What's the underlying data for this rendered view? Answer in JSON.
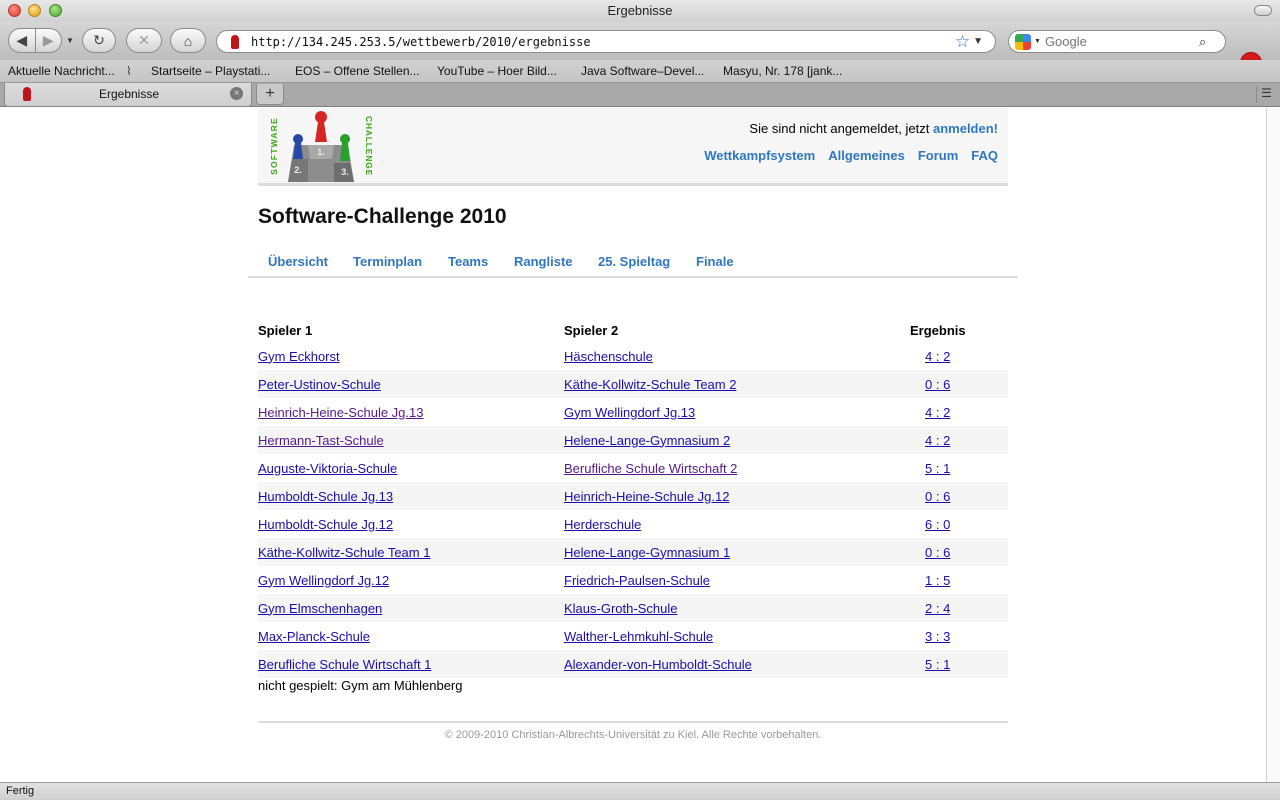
{
  "window": {
    "title": "Ergebnisse"
  },
  "toolbar": {
    "url": "http://134.245.253.5/wettbewerb/2010/ergebnisse",
    "search_placeholder": "Google",
    "abp_label": "ABP"
  },
  "bookmarks": [
    "Aktuelle Nachricht...",
    "Startseite – Playstati...",
    "EOS – Offene Stellen...",
    "YouTube – Hoer Bild...",
    "Java Software–Devel...",
    "Masyu, Nr. 178 [jank..."
  ],
  "tab": {
    "label": "Ergebnisse"
  },
  "status": {
    "text": "Fertig"
  },
  "header": {
    "login_text": "Sie sind nicht angemeldet, jetzt ",
    "login_link": "anmelden!",
    "nav": [
      "Wettkampfsystem",
      "Allgemeines",
      "Forum",
      "FAQ"
    ],
    "logo_text_left": "SOFTWARE",
    "logo_text_right": "CHALLENGE",
    "podium": [
      "2.",
      "1.",
      "3."
    ]
  },
  "page": {
    "title": "Software-Challenge 2010",
    "subnav": [
      "Übersicht",
      "Terminplan",
      "Teams",
      "Rangliste",
      "25. Spieltag",
      "Finale"
    ]
  },
  "results": {
    "headers": {
      "player1": "Spieler 1",
      "player2": "Spieler 2",
      "result": "Ergebnis"
    },
    "rows": [
      {
        "p1": "Gym Eckhorst",
        "p2": "Häschenschule",
        "res": "4 : 2"
      },
      {
        "p1": "Peter-Ustinov-Schule",
        "p2": "Käthe-Kollwitz-Schule Team 2",
        "res": "0 : 6"
      },
      {
        "p1": "Heinrich-Heine-Schule Jg.13",
        "p2": "Gym Wellingdorf Jg.13",
        "res": "4 : 2"
      },
      {
        "p1": "Hermann-Tast-Schule",
        "p2": "Helene-Lange-Gymnasium 2",
        "res": "4 : 2"
      },
      {
        "p1": "Auguste-Viktoria-Schule",
        "p2": "Berufliche Schule Wirtschaft 2",
        "res": "5 : 1"
      },
      {
        "p1": "Humboldt-Schule Jg.13",
        "p2": "Heinrich-Heine-Schule Jg.12",
        "res": "0 : 6"
      },
      {
        "p1": "Humboldt-Schule Jg.12",
        "p2": "Herderschule",
        "res": "6 : 0"
      },
      {
        "p1": "Käthe-Kollwitz-Schule Team 1",
        "p2": "Helene-Lange-Gymnasium 1",
        "res": "0 : 6"
      },
      {
        "p1": "Gym Wellingdorf Jg.12",
        "p2": "Friedrich-Paulsen-Schule",
        "res": "1 : 5"
      },
      {
        "p1": "Gym Elmschenhagen",
        "p2": "Klaus-Groth-Schule",
        "res": "2 : 4"
      },
      {
        "p1": "Max-Planck-Schule",
        "p2": "Walther-Lehmkuhl-Schule",
        "res": "3 : 3"
      },
      {
        "p1": "Berufliche Schule Wirtschaft 1",
        "p2": "Alexander-von-Humboldt-Schule",
        "res": "5 : 1"
      }
    ],
    "not_played": "nicht gespielt: Gym am Mühlenberg"
  },
  "footer": {
    "text": "© 2009-2010 Christian-Albrechts-Universität zu Kiel. Alle Rechte vorbehalten."
  },
  "colors": {
    "link": "#2f77c0",
    "row_alt": "#f5f5f5"
  }
}
